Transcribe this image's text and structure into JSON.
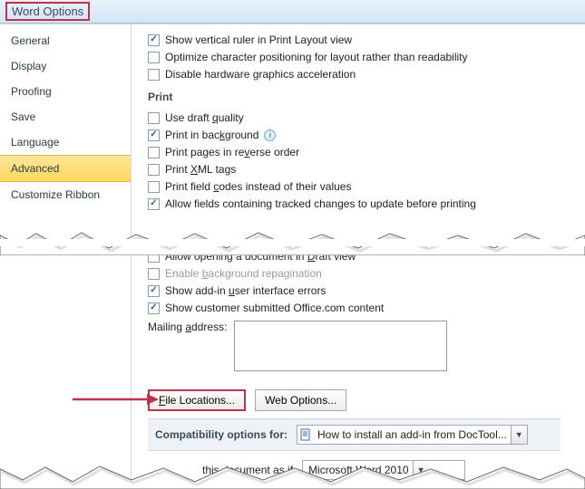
{
  "window": {
    "title": "Word Options"
  },
  "sidebar": {
    "items": [
      {
        "label": "General"
      },
      {
        "label": "Display"
      },
      {
        "label": "Proofing"
      },
      {
        "label": "Save"
      },
      {
        "label": "Language"
      },
      {
        "label": "Advanced",
        "selected": true
      },
      {
        "label": "Customize Ribbon"
      }
    ]
  },
  "top_checks": [
    {
      "label": "Show vertical ruler in Print Layout view",
      "checked": true
    },
    {
      "label": "Optimize character positioning for layout rather than readability",
      "checked": false
    },
    {
      "label": "Disable hardware graphics acceleration",
      "checked": false
    }
  ],
  "print": {
    "title": "Print",
    "options": [
      {
        "label_pre": "Use draft ",
        "key": "q",
        "label_post": "uality",
        "checked": false
      },
      {
        "label_pre": "Print in bac",
        "key": "k",
        "label_post": "ground",
        "checked": true,
        "info": true
      },
      {
        "label_pre": "Print pages in re",
        "key": "v",
        "label_post": "erse order",
        "checked": false
      },
      {
        "label_pre": "Print ",
        "key": "X",
        "label_post": "ML tags",
        "checked": false
      },
      {
        "label_pre": "Print field ",
        "key": "c",
        "label_post": "odes instead of their values",
        "checked": false
      },
      {
        "label_pre": "Allow fields containing tracked changes to update before printing",
        "key": "",
        "label_post": "",
        "checked": true
      }
    ]
  },
  "general": {
    "options": [
      {
        "label_pre": "Allow opening a document in ",
        "key": "D",
        "label_post": "raft view",
        "checked": false
      },
      {
        "label_pre": "Enable ",
        "key": "b",
        "label_post": "ackground repagination",
        "checked": false,
        "disabled": true
      },
      {
        "label_pre": "Show add-in ",
        "key": "u",
        "label_post": "ser interface errors",
        "checked": true
      },
      {
        "label_pre": "Show customer submitted Office.com content",
        "key": "",
        "label_post": "",
        "checked": true
      }
    ],
    "mailing_label_pre": "Mailing ",
    "mailing_key": "a",
    "mailing_label_post": "ddress:",
    "mailing_value": ""
  },
  "buttons": {
    "file_locations_pre": "",
    "file_locations_key": "F",
    "file_locations_post": "ile Locations...",
    "web_options": "Web Options..."
  },
  "compat": {
    "label": "Compatibility options for:",
    "selected": "How to install an add-in from DocTool..."
  },
  "bottom": {
    "text": "this document as if",
    "selected": "Microsoft Word 2010"
  }
}
